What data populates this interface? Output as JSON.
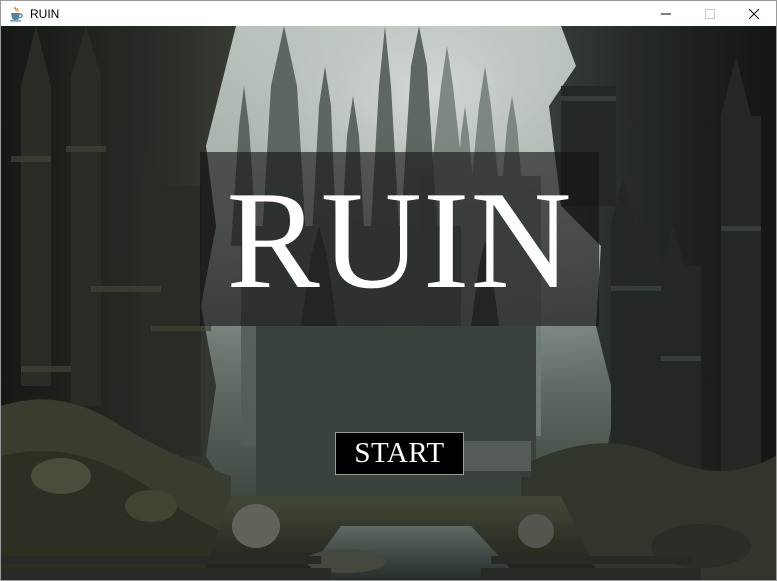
{
  "window": {
    "title": "RUIN",
    "app_icon": "java-coffee-cup-icon",
    "controls": {
      "minimize_icon": "minimize-icon",
      "maximize_icon": "maximize-icon",
      "close_icon": "close-icon"
    }
  },
  "game": {
    "title": "RUIN",
    "start_label": "START",
    "background": "ruined-gothic-city-canyon",
    "colors": {
      "title_text": "#ffffff",
      "title_panel": "rgba(20,20,20,0.62)",
      "button_bg": "#000000",
      "button_border": "#9a9a9a",
      "button_text": "#ffffff"
    }
  }
}
